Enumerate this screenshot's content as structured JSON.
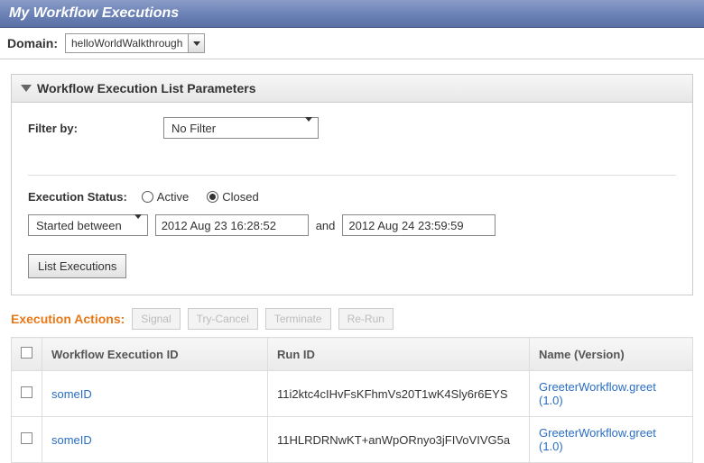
{
  "title": "My Workflow Executions",
  "domain": {
    "label": "Domain:",
    "value": "helloWorldWalkthrough"
  },
  "params_panel": {
    "title": "Workflow Execution List Parameters",
    "filter": {
      "label": "Filter by:",
      "value": "No Filter"
    },
    "status": {
      "label": "Execution Status:",
      "options": [
        {
          "label": "Active",
          "selected": false
        },
        {
          "label": "Closed",
          "selected": true
        }
      ]
    },
    "date_mode": "Started between",
    "from": "2012 Aug 23 16:28:52",
    "and": "and",
    "to": "2012 Aug 24 23:59:59",
    "list_button": "List Executions"
  },
  "actions": {
    "title": "Execution Actions:",
    "buttons": [
      "Signal",
      "Try-Cancel",
      "Terminate",
      "Re-Run"
    ]
  },
  "table": {
    "headers": {
      "wf": "Workflow Execution ID",
      "run": "Run ID",
      "name": "Name (Version)"
    },
    "rows": [
      {
        "wf_id": "someID",
        "run_id": "11i2ktc4cIHvFsKFhmVs20T1wK4Sly6r6EYS",
        "name": "GreeterWorkflow.greet (1.0)"
      },
      {
        "wf_id": "someID",
        "run_id": "11HLRDRNwKT+anWpORnyo3jFIVoVIVG5a",
        "name": "GreeterWorkflow.greet (1.0)"
      }
    ]
  }
}
